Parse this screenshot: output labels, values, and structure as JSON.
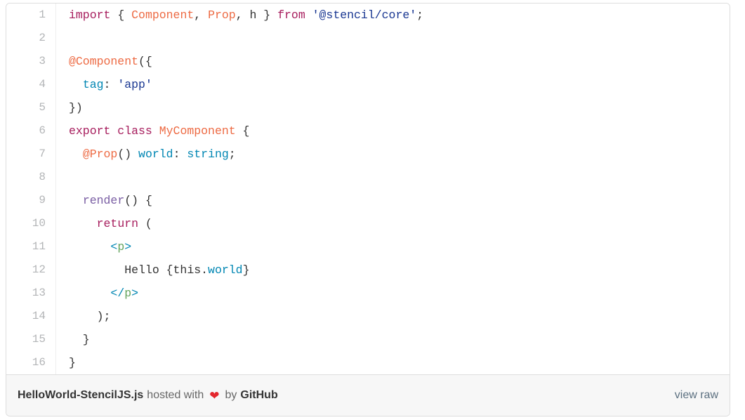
{
  "gist": {
    "code_lines": [
      {
        "number": "1",
        "tokens": [
          {
            "t": "import",
            "c": "k"
          },
          {
            "t": " { ",
            "c": "p"
          },
          {
            "t": "Component",
            "c": "e"
          },
          {
            "t": ", ",
            "c": "p"
          },
          {
            "t": "Prop",
            "c": "e"
          },
          {
            "t": ", h } ",
            "c": "p"
          },
          {
            "t": "from",
            "c": "k"
          },
          {
            "t": " ",
            "c": "p"
          },
          {
            "t": "'@stencil/core'",
            "c": "s"
          },
          {
            "t": ";",
            "c": "p"
          }
        ]
      },
      {
        "number": "2",
        "tokens": []
      },
      {
        "number": "3",
        "tokens": [
          {
            "t": "@Component",
            "c": "e"
          },
          {
            "t": "({",
            "c": "p"
          }
        ]
      },
      {
        "number": "4",
        "tokens": [
          {
            "t": "  ",
            "c": "p"
          },
          {
            "t": "tag",
            "c": "c"
          },
          {
            "t": ": ",
            "c": "p"
          },
          {
            "t": "'app'",
            "c": "s"
          }
        ]
      },
      {
        "number": "5",
        "tokens": [
          {
            "t": "})",
            "c": "p"
          }
        ]
      },
      {
        "number": "6",
        "tokens": [
          {
            "t": "export class",
            "c": "k"
          },
          {
            "t": " ",
            "c": "p"
          },
          {
            "t": "MyComponent",
            "c": "e"
          },
          {
            "t": " {",
            "c": "p"
          }
        ]
      },
      {
        "number": "7",
        "tokens": [
          {
            "t": "  ",
            "c": "p"
          },
          {
            "t": "@Prop",
            "c": "e"
          },
          {
            "t": "() ",
            "c": "p"
          },
          {
            "t": "world",
            "c": "c"
          },
          {
            "t": ": ",
            "c": "p"
          },
          {
            "t": "string",
            "c": "c"
          },
          {
            "t": ";",
            "c": "p"
          }
        ]
      },
      {
        "number": "8",
        "tokens": []
      },
      {
        "number": "9",
        "tokens": [
          {
            "t": "  ",
            "c": "p"
          },
          {
            "t": "render",
            "c": "f"
          },
          {
            "t": "() {",
            "c": "p"
          }
        ]
      },
      {
        "number": "10",
        "tokens": [
          {
            "t": "    ",
            "c": "p"
          },
          {
            "t": "return",
            "c": "k"
          },
          {
            "t": " (",
            "c": "p"
          }
        ]
      },
      {
        "number": "11",
        "tokens": [
          {
            "t": "      ",
            "c": "p"
          },
          {
            "t": "<",
            "c": "tb"
          },
          {
            "t": "p",
            "c": "tn"
          },
          {
            "t": ">",
            "c": "tb"
          }
        ]
      },
      {
        "number": "12",
        "tokens": [
          {
            "t": "        Hello {this.",
            "c": "p"
          },
          {
            "t": "world",
            "c": "c"
          },
          {
            "t": "}",
            "c": "p"
          }
        ]
      },
      {
        "number": "13",
        "tokens": [
          {
            "t": "      ",
            "c": "p"
          },
          {
            "t": "</",
            "c": "tb"
          },
          {
            "t": "p",
            "c": "tn"
          },
          {
            "t": ">",
            "c": "tb"
          }
        ]
      },
      {
        "number": "14",
        "tokens": [
          {
            "t": "    );",
            "c": "p"
          }
        ]
      },
      {
        "number": "15",
        "tokens": [
          {
            "t": "  }",
            "c": "p"
          }
        ]
      },
      {
        "number": "16",
        "tokens": [
          {
            "t": "}",
            "c": "p"
          }
        ]
      }
    ],
    "meta": {
      "filename": "HelloWorld-StencilJS.js",
      "hosted_with": "hosted with",
      "heart_icon": "heart-icon",
      "heart_glyph": "❤",
      "by": "by",
      "brand": "GitHub",
      "view_raw": "view raw"
    },
    "colors": {
      "keyword": "#a71d5d",
      "entity": "#ed6a43",
      "string": "#183691",
      "constant": "#0086b3",
      "function": "#795da3",
      "tag_name": "#63a35c",
      "plain": "#333333",
      "line_number": "#b3b5b7",
      "heart": "#e4272e",
      "footer_background": "#f7f7f7",
      "border": "#dddddd",
      "link": "#5c7080"
    }
  }
}
